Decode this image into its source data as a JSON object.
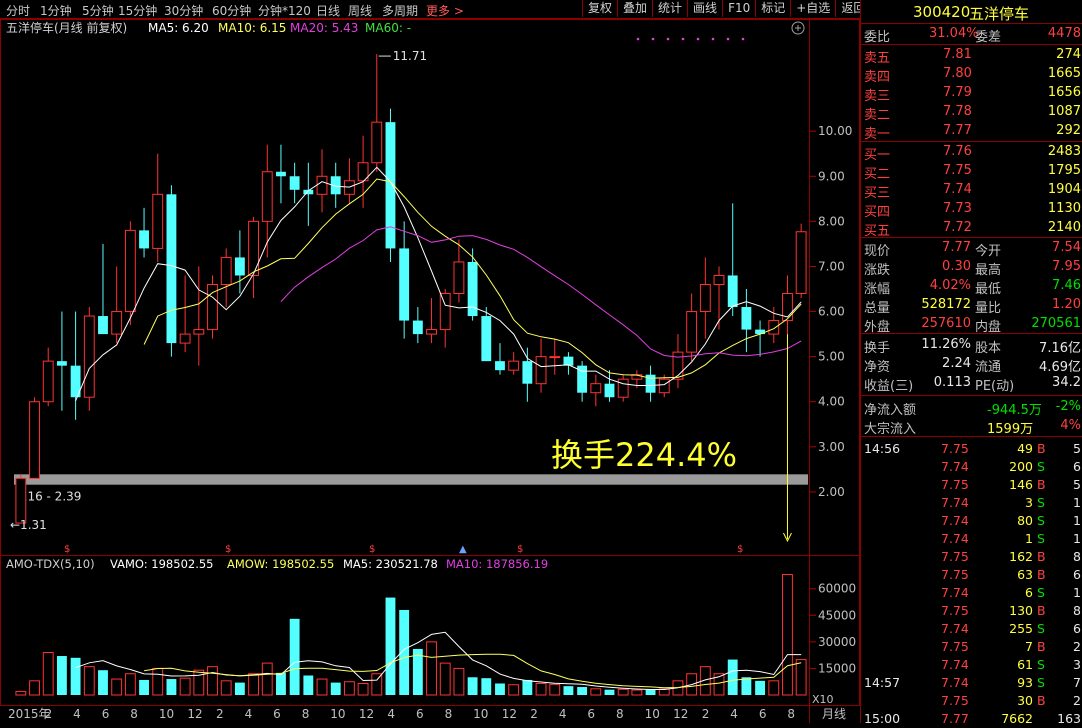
{
  "top_nav": {
    "items": [
      "分时",
      "1分钟",
      "5分钟",
      "15分钟",
      "30分钟",
      "60分钟",
      "分钟*120",
      "日线",
      "周线",
      "多周期"
    ],
    "more": "更多 >"
  },
  "right_tools": [
    "复权",
    "叠加",
    "统计",
    "画线",
    "F10",
    "标记",
    "+自选",
    "返回"
  ],
  "price_panel": {
    "title": "五洋停车(月线 前复权)",
    "ma5": "MA5: 6.20",
    "ma10": "MA10: 6.15",
    "ma20": "MA20: 5.43",
    "ma60": "MA60: -",
    "high_label": "11.71",
    "low_label": "1.31",
    "band_label": "2.16 - 2.39",
    "annotation": "换手224.4%",
    "y_ticks": [
      "10.00",
      "9.00",
      "8.00",
      "7.00",
      "6.00",
      "5.00",
      "4.00",
      "3.00",
      "2.00"
    ]
  },
  "volume_panel": {
    "title": "AMO-TDX(5,10)",
    "vamo": "VAMO: 198502.55",
    "amow": "AMOW: 198502.55",
    "ma5": "MA5: 230521.78",
    "ma10": "MA10: 187856.19",
    "y_ticks": [
      "60000",
      "45000",
      "30000",
      "15000"
    ],
    "unit": "X10"
  },
  "x_axis": {
    "labels": [
      "2015年",
      "2",
      "4",
      "6",
      "8",
      "10",
      "12",
      "2",
      "4",
      "6",
      "8",
      "10",
      "12",
      "4",
      "6",
      "8",
      "10",
      "12",
      "2",
      "4",
      "6",
      "8",
      "10",
      "12",
      "2",
      "4",
      "6",
      "8"
    ],
    "period": "月线"
  },
  "colors": {
    "up": "#ff3232",
    "down": "#54ffff",
    "ma5": "#ffffff",
    "ma10": "#ffff60",
    "ma20": "#e040e0",
    "band": "#9a9a9a",
    "annot": "#ffff30"
  },
  "chart_data": {
    "type": "candlestick",
    "candles": [
      {
        "o": 1.31,
        "h": 2.39,
        "l": 1.31,
        "c": 2.3
      },
      {
        "o": 2.3,
        "h": 4.1,
        "l": 2.3,
        "c": 4.0
      },
      {
        "o": 4.0,
        "h": 5.2,
        "l": 3.9,
        "c": 4.9
      },
      {
        "o": 4.9,
        "h": 6.0,
        "l": 3.8,
        "c": 4.8
      },
      {
        "o": 4.8,
        "h": 6.0,
        "l": 3.6,
        "c": 4.1
      },
      {
        "o": 4.1,
        "h": 6.1,
        "l": 3.8,
        "c": 5.9
      },
      {
        "o": 5.9,
        "h": 7.5,
        "l": 5.5,
        "c": 5.5
      },
      {
        "o": 5.5,
        "h": 7.0,
        "l": 5.3,
        "c": 6.0
      },
      {
        "o": 6.0,
        "h": 8.0,
        "l": 5.7,
        "c": 7.8
      },
      {
        "o": 7.8,
        "h": 8.3,
        "l": 7.2,
        "c": 7.4
      },
      {
        "o": 7.4,
        "h": 9.5,
        "l": 7.1,
        "c": 8.6
      },
      {
        "o": 8.6,
        "h": 8.8,
        "l": 5.0,
        "c": 5.3
      },
      {
        "o": 5.3,
        "h": 6.8,
        "l": 5.1,
        "c": 5.5
      },
      {
        "o": 5.5,
        "h": 7.0,
        "l": 4.8,
        "c": 5.6
      },
      {
        "o": 5.6,
        "h": 6.8,
        "l": 5.4,
        "c": 6.6
      },
      {
        "o": 6.6,
        "h": 7.4,
        "l": 6.1,
        "c": 7.2
      },
      {
        "o": 7.2,
        "h": 7.8,
        "l": 6.4,
        "c": 6.8
      },
      {
        "o": 6.8,
        "h": 8.1,
        "l": 6.3,
        "c": 8.0
      },
      {
        "o": 8.0,
        "h": 9.7,
        "l": 7.2,
        "c": 9.1
      },
      {
        "o": 9.1,
        "h": 9.7,
        "l": 8.4,
        "c": 9.0
      },
      {
        "o": 9.0,
        "h": 9.3,
        "l": 8.4,
        "c": 8.7
      },
      {
        "o": 8.7,
        "h": 9.3,
        "l": 7.9,
        "c": 8.6
      },
      {
        "o": 8.6,
        "h": 9.6,
        "l": 8.2,
        "c": 9.0
      },
      {
        "o": 9.0,
        "h": 9.3,
        "l": 8.3,
        "c": 8.6
      },
      {
        "o": 8.6,
        "h": 9.4,
        "l": 8.4,
        "c": 8.9
      },
      {
        "o": 8.9,
        "h": 9.9,
        "l": 8.3,
        "c": 9.3
      },
      {
        "o": 9.3,
        "h": 11.71,
        "l": 9.1,
        "c": 10.2
      },
      {
        "o": 10.2,
        "h": 10.5,
        "l": 7.1,
        "c": 7.4
      },
      {
        "o": 7.4,
        "h": 8.0,
        "l": 5.4,
        "c": 5.8
      },
      {
        "o": 5.8,
        "h": 6.1,
        "l": 5.3,
        "c": 5.5
      },
      {
        "o": 5.5,
        "h": 6.3,
        "l": 5.3,
        "c": 5.6
      },
      {
        "o": 5.6,
        "h": 6.5,
        "l": 5.2,
        "c": 6.4
      },
      {
        "o": 6.4,
        "h": 7.6,
        "l": 6.2,
        "c": 7.1
      },
      {
        "o": 7.1,
        "h": 7.4,
        "l": 5.8,
        "c": 5.9
      },
      {
        "o": 5.9,
        "h": 6.1,
        "l": 4.9,
        "c": 4.9
      },
      {
        "o": 4.9,
        "h": 5.3,
        "l": 4.6,
        "c": 4.7
      },
      {
        "o": 4.7,
        "h": 5.1,
        "l": 4.6,
        "c": 4.9
      },
      {
        "o": 4.9,
        "h": 5.2,
        "l": 4.0,
        "c": 4.4
      },
      {
        "o": 4.4,
        "h": 5.4,
        "l": 4.2,
        "c": 5.0
      },
      {
        "o": 5.0,
        "h": 5.4,
        "l": 4.6,
        "c": 5.0
      },
      {
        "o": 5.0,
        "h": 5.1,
        "l": 4.6,
        "c": 4.8
      },
      {
        "o": 4.8,
        "h": 4.9,
        "l": 4.0,
        "c": 4.2
      },
      {
        "o": 4.2,
        "h": 4.6,
        "l": 3.9,
        "c": 4.4
      },
      {
        "o": 4.4,
        "h": 4.7,
        "l": 4.0,
        "c": 4.1
      },
      {
        "o": 4.1,
        "h": 4.6,
        "l": 4.0,
        "c": 4.5
      },
      {
        "o": 4.5,
        "h": 4.7,
        "l": 4.3,
        "c": 4.6
      },
      {
        "o": 4.6,
        "h": 4.8,
        "l": 4.0,
        "c": 4.2
      },
      {
        "o": 4.2,
        "h": 4.6,
        "l": 4.1,
        "c": 4.5
      },
      {
        "o": 4.5,
        "h": 5.5,
        "l": 4.3,
        "c": 5.1
      },
      {
        "o": 5.1,
        "h": 6.4,
        "l": 4.9,
        "c": 6.0
      },
      {
        "o": 6.0,
        "h": 7.2,
        "l": 5.4,
        "c": 6.6
      },
      {
        "o": 6.6,
        "h": 7.0,
        "l": 5.6,
        "c": 6.8
      },
      {
        "o": 6.8,
        "h": 8.4,
        "l": 5.9,
        "c": 6.1
      },
      {
        "o": 6.1,
        "h": 6.5,
        "l": 5.1,
        "c": 5.6
      },
      {
        "o": 5.6,
        "h": 5.8,
        "l": 5.0,
        "c": 5.5
      },
      {
        "o": 5.5,
        "h": 6.1,
        "l": 5.3,
        "c": 5.8
      },
      {
        "o": 5.8,
        "h": 6.8,
        "l": 5.5,
        "c": 6.4
      },
      {
        "o": 6.4,
        "h": 7.95,
        "l": 6.3,
        "c": 7.77
      }
    ],
    "volume": [
      2000,
      8000,
      24000,
      22000,
      21000,
      16000,
      14000,
      9000,
      12000,
      8500,
      15000,
      9000,
      9500,
      14000,
      16000,
      8000,
      7000,
      12000,
      18000,
      12500,
      43000,
      11000,
      9000,
      7000,
      7500,
      6500,
      12000,
      55000,
      48000,
      26000,
      30000,
      18000,
      15000,
      10000,
      9500,
      6500,
      5800,
      8500,
      6500,
      6000,
      5000,
      4500,
      3500,
      3000,
      3200,
      2800,
      3000,
      3500,
      8000,
      12000,
      16000,
      12000,
      20000,
      10000,
      8000,
      8000,
      68000,
      20000
    ],
    "ylim": [
      1.0,
      12.0
    ],
    "vol_ylim": [
      0,
      70000
    ]
  },
  "quote": {
    "code": "300420",
    "name": "五洋停车",
    "weibi_label": "委比",
    "weibi": "31.04%",
    "weicha_label": "委差",
    "weicha": "4478",
    "asks": [
      {
        "label": "卖五",
        "price": "7.81",
        "vol": "274"
      },
      {
        "label": "卖四",
        "price": "7.80",
        "vol": "1665"
      },
      {
        "label": "卖三",
        "price": "7.79",
        "vol": "1656"
      },
      {
        "label": "卖二",
        "price": "7.78",
        "vol": "1087"
      },
      {
        "label": "卖一",
        "price": "7.77",
        "vol": "292"
      }
    ],
    "bids": [
      {
        "label": "买一",
        "price": "7.76",
        "vol": "2483"
      },
      {
        "label": "买二",
        "price": "7.75",
        "vol": "1795"
      },
      {
        "label": "买三",
        "price": "7.74",
        "vol": "1904"
      },
      {
        "label": "买四",
        "price": "7.73",
        "vol": "1130"
      },
      {
        "label": "买五",
        "price": "7.72",
        "vol": "2140"
      }
    ],
    "stats": [
      {
        "l1": "现价",
        "v1": "7.77",
        "l2": "今开",
        "v2": "7.54",
        "c1": "red",
        "c2": "red"
      },
      {
        "l1": "涨跌",
        "v1": "0.30",
        "l2": "最高",
        "v2": "7.95",
        "c1": "red",
        "c2": "red"
      },
      {
        "l1": "涨幅",
        "v1": "4.02%",
        "l2": "最低",
        "v2": "7.46",
        "c1": "red",
        "c2": "green"
      },
      {
        "l1": "总量",
        "v1": "528172",
        "l2": "量比",
        "v2": "1.20",
        "c1": "yellow",
        "c2": "red"
      },
      {
        "l1": "外盘",
        "v1": "257610",
        "l2": "内盘",
        "v2": "270561",
        "c1": "red",
        "c2": "green"
      }
    ],
    "stats2": [
      {
        "l1": "换手",
        "v1": "11.26%",
        "l2": "股本",
        "v2": "7.16亿",
        "c1": "white",
        "c2": "white"
      },
      {
        "l1": "净资",
        "v1": "2.24",
        "l2": "流通",
        "v2": "4.69亿",
        "c1": "white",
        "c2": "white"
      },
      {
        "l1": "收益(三)",
        "v1": "0.113",
        "l2": "PE(动)",
        "v2": "34.2",
        "c1": "white",
        "c2": "white"
      }
    ],
    "flows": [
      {
        "label": "净流入额",
        "value": "-944.5万",
        "pct": "-2%",
        "vc": "green",
        "pc": "green"
      },
      {
        "label": "大宗流入",
        "value": "1599万",
        "pct": "4%",
        "vc": "yellow",
        "pc": "red"
      }
    ],
    "ticks": [
      {
        "time": "14:56",
        "price": "7.75",
        "vol": "49",
        "bs": "B",
        "n": "5"
      },
      {
        "time": "",
        "price": "7.74",
        "vol": "200",
        "bs": "S",
        "n": "6"
      },
      {
        "time": "",
        "price": "7.75",
        "vol": "146",
        "bs": "B",
        "n": "5"
      },
      {
        "time": "",
        "price": "7.74",
        "vol": "3",
        "bs": "S",
        "n": "1"
      },
      {
        "time": "",
        "price": "7.74",
        "vol": "80",
        "bs": "S",
        "n": "1"
      },
      {
        "time": "",
        "price": "7.74",
        "vol": "1",
        "bs": "S",
        "n": "1"
      },
      {
        "time": "",
        "price": "7.75",
        "vol": "162",
        "bs": "B",
        "n": "8"
      },
      {
        "time": "",
        "price": "7.75",
        "vol": "63",
        "bs": "B",
        "n": "6"
      },
      {
        "time": "",
        "price": "7.74",
        "vol": "6",
        "bs": "S",
        "n": "1"
      },
      {
        "time": "",
        "price": "7.75",
        "vol": "130",
        "bs": "B",
        "n": "8"
      },
      {
        "time": "",
        "price": "7.74",
        "vol": "255",
        "bs": "S",
        "n": "6"
      },
      {
        "time": "",
        "price": "7.75",
        "vol": "7",
        "bs": "B",
        "n": "2"
      },
      {
        "time": "",
        "price": "7.74",
        "vol": "61",
        "bs": "S",
        "n": "3"
      },
      {
        "time": "14:57",
        "price": "7.74",
        "vol": "93",
        "bs": "S",
        "n": "7"
      },
      {
        "time": "",
        "price": "7.75",
        "vol": "30",
        "bs": "B",
        "n": "2"
      },
      {
        "time": "15:00",
        "price": "7.77",
        "vol": "7662",
        "bs": "",
        "n": "163"
      }
    ]
  }
}
